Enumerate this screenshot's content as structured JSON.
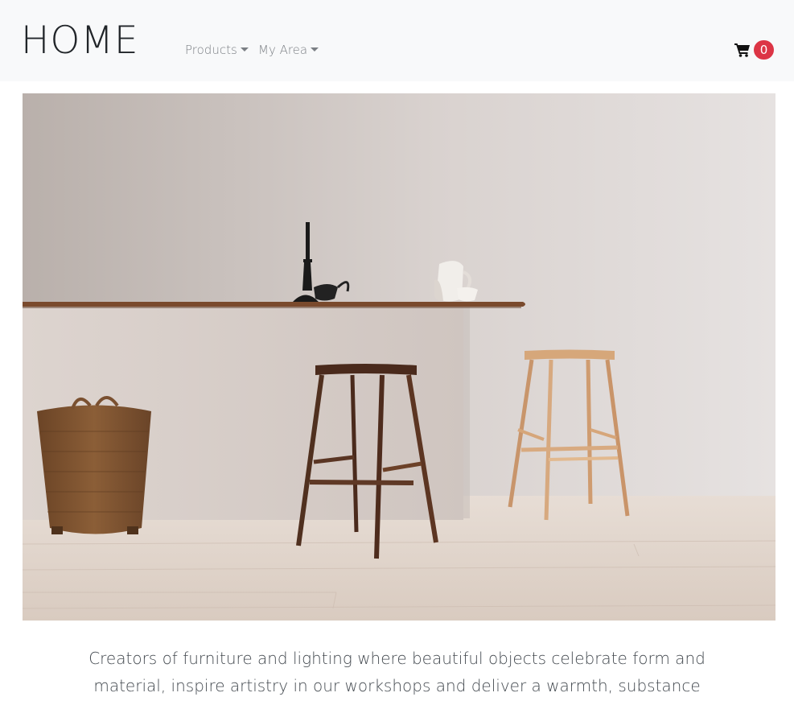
{
  "brand": {
    "title": "HOME"
  },
  "nav": {
    "items": [
      {
        "label": "Products"
      },
      {
        "label": "My Area"
      }
    ]
  },
  "cart": {
    "icon": "shopping-cart-icon",
    "count": "0",
    "badge_color": "#dc3545"
  },
  "hero": {
    "image": "furniture-scene-with-two-bar-stools"
  },
  "tagline": "Creators of furniture and lighting where beautiful objects celebrate form and material, inspire artistry in our workshops and deliver a warmth, substance",
  "colors": {
    "navbar_bg": "#f8f9fa",
    "text": "#212529",
    "nav_text": "#7b7f84"
  }
}
